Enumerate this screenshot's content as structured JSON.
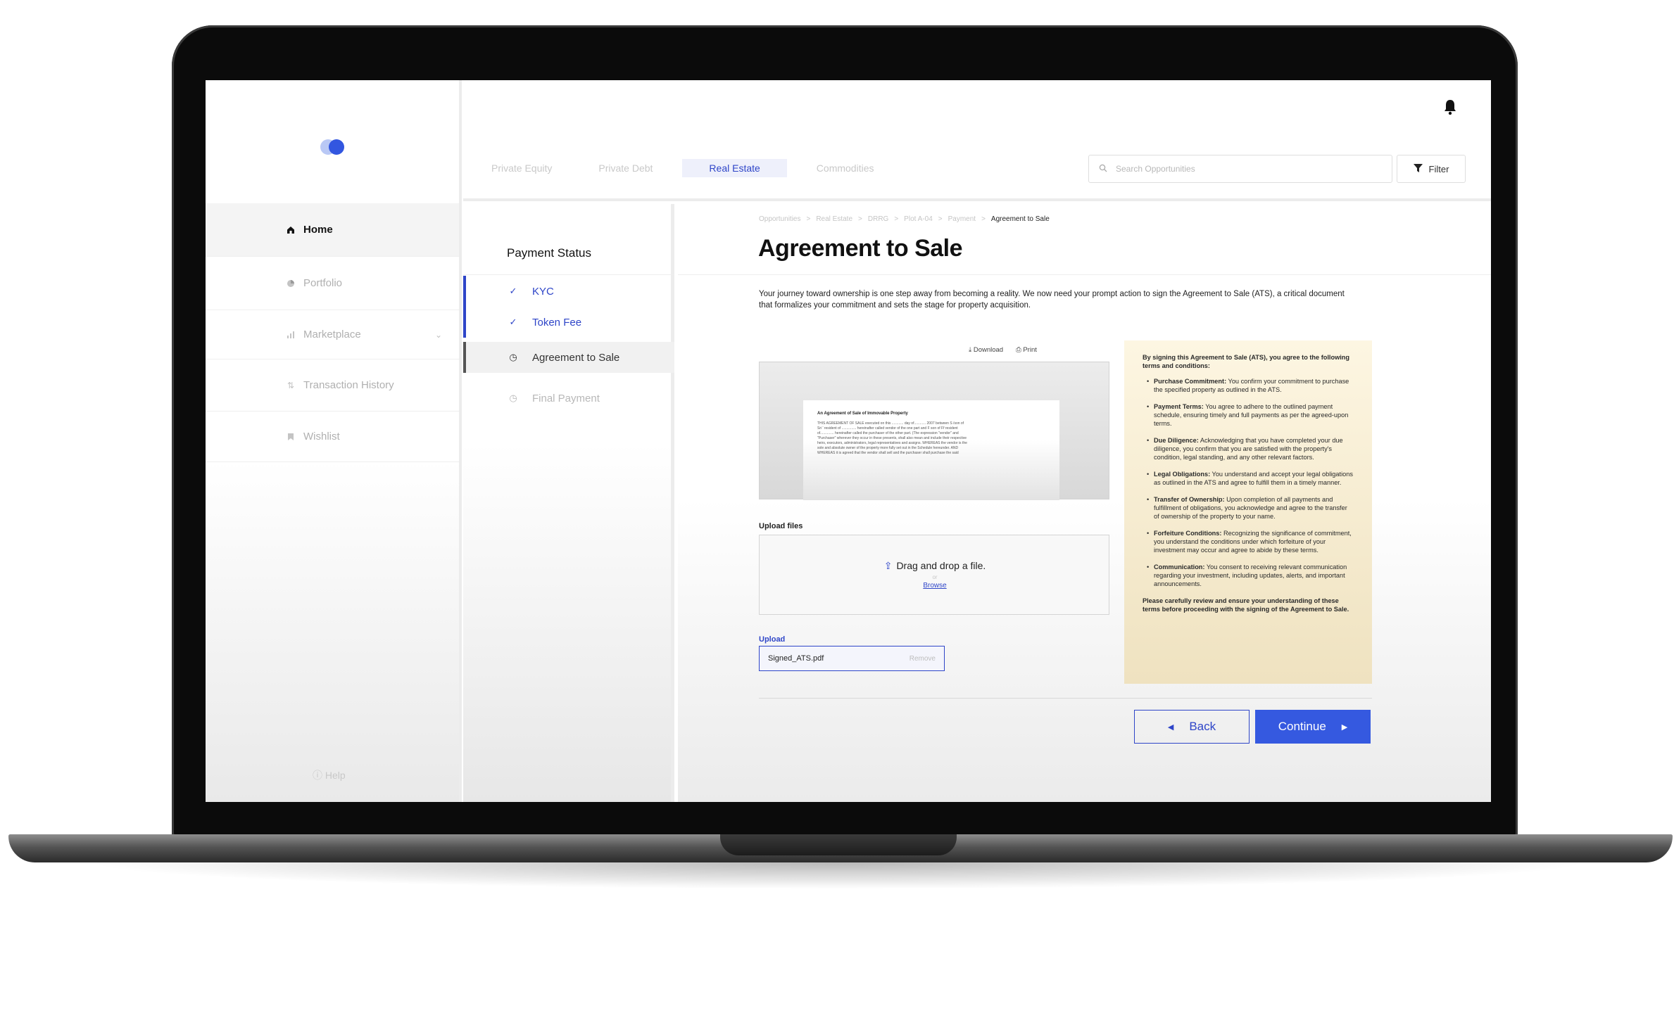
{
  "sidebar": {
    "items": [
      {
        "label": "Home",
        "icon": "home-icon"
      },
      {
        "label": "Portfolio",
        "icon": "pie-chart-icon"
      },
      {
        "label": "Marketplace",
        "icon": "bar-chart-icon"
      },
      {
        "label": "Transaction History",
        "icon": "swap-icon"
      },
      {
        "label": "Wishlist",
        "icon": "bookmark-icon"
      }
    ],
    "help": "Help"
  },
  "topbar": {
    "tabs": [
      "Private Equity",
      "Private Debt",
      "Real Estate",
      "Commodities"
    ],
    "active_tab": "Real Estate",
    "search_placeholder": "Search Opportunities",
    "filter_label": "Filter"
  },
  "payment_status": {
    "title": "Payment Status",
    "steps": [
      {
        "label": "KYC",
        "state": "done"
      },
      {
        "label": "Token Fee",
        "state": "done"
      },
      {
        "label": "Agreement to Sale",
        "state": "current"
      },
      {
        "label": "Final Payment",
        "state": "todo"
      }
    ]
  },
  "main": {
    "breadcrumb": [
      "Opportunities",
      "Real Estate",
      "DRRG",
      "Plot A-04",
      "Payment",
      "Agreement to Sale"
    ],
    "title": "Agreement to Sale",
    "intro": "Your journey toward ownership is one step away from becoming a reality. We now need your prompt action to sign the Agreement to Sale (ATS), a critical document that formalizes your commitment and sets the stage for property acquisition.",
    "download_label": "Download",
    "print_label": "Print",
    "document": {
      "heading": "An Agreement of Sale of Immovable Property",
      "lines": [
        "THIS AGREEMENT OF SALE executed on this ............ day of............ 2007 between S /son of",
        "Sri ' resident of ............... hereinafter called vendor of the one part and F son of Ff resident",
        "of.............. hereinafter called the purchaser of the other part. (The expression \"vendor\" and",
        "\"Purchaser\" wherever they occur in these presents, shall also mean and include their respective",
        "heirs, executors, administrators, legal representatives and assigns. WHEREAS the vendor is the",
        "sole and absolute owner of the property more fully set out in the Schedule hereunder. AND",
        "WHEREAS it is agreed that the vendor shall sell and the purchaser shall purchase the said"
      ]
    },
    "upload_files_label": "Upload files",
    "drop_text": "Drag and drop a file.",
    "drop_or": "or",
    "browse_label": "Browse",
    "upload_label": "Upload",
    "uploaded_file": "Signed_ATS.pdf",
    "remove_label": "Remove",
    "terms": {
      "heading": "By signing this Agreement to Sale (ATS), you agree to the following terms and conditions:",
      "items": [
        {
          "title": "Purchase Commitment:",
          "text": "You confirm your commitment to purchase the specified property as outlined in the ATS."
        },
        {
          "title": "Payment Terms:",
          "text": "You agree to adhere to the outlined payment schedule, ensuring timely and full payments as per the agreed-upon terms."
        },
        {
          "title": "Due Diligence:",
          "text": "Acknowledging that you have completed your due diligence, you confirm that you are satisfied with the property's condition, legal standing, and any other relevant factors."
        },
        {
          "title": "Legal Obligations:",
          "text": "You understand and accept your legal obligations as outlined in the ATS and agree to fulfill them in a timely manner."
        },
        {
          "title": "Transfer of Ownership:",
          "text": "Upon completion of all payments and fulfillment of obligations, you acknowledge and agree to the transfer of ownership of the property to your name."
        },
        {
          "title": "Forfeiture Conditions:",
          "text": "Recognizing the significance of commitment, you understand the conditions under which forfeiture of your investment may occur and agree to abide by these terms."
        },
        {
          "title": "Communication:",
          "text": "You consent to receiving relevant communication regarding your investment, including updates, alerts, and important announcements."
        }
      ],
      "footer": "Please carefully review and ensure your understanding of these terms before proceeding with the signing of the Agreement to Sale."
    },
    "back_label": "Back",
    "continue_label": "Continue"
  },
  "colors": {
    "accent": "#3559e0",
    "accent_text": "#2e45c8",
    "terms_bg": "#fdf6e2"
  }
}
